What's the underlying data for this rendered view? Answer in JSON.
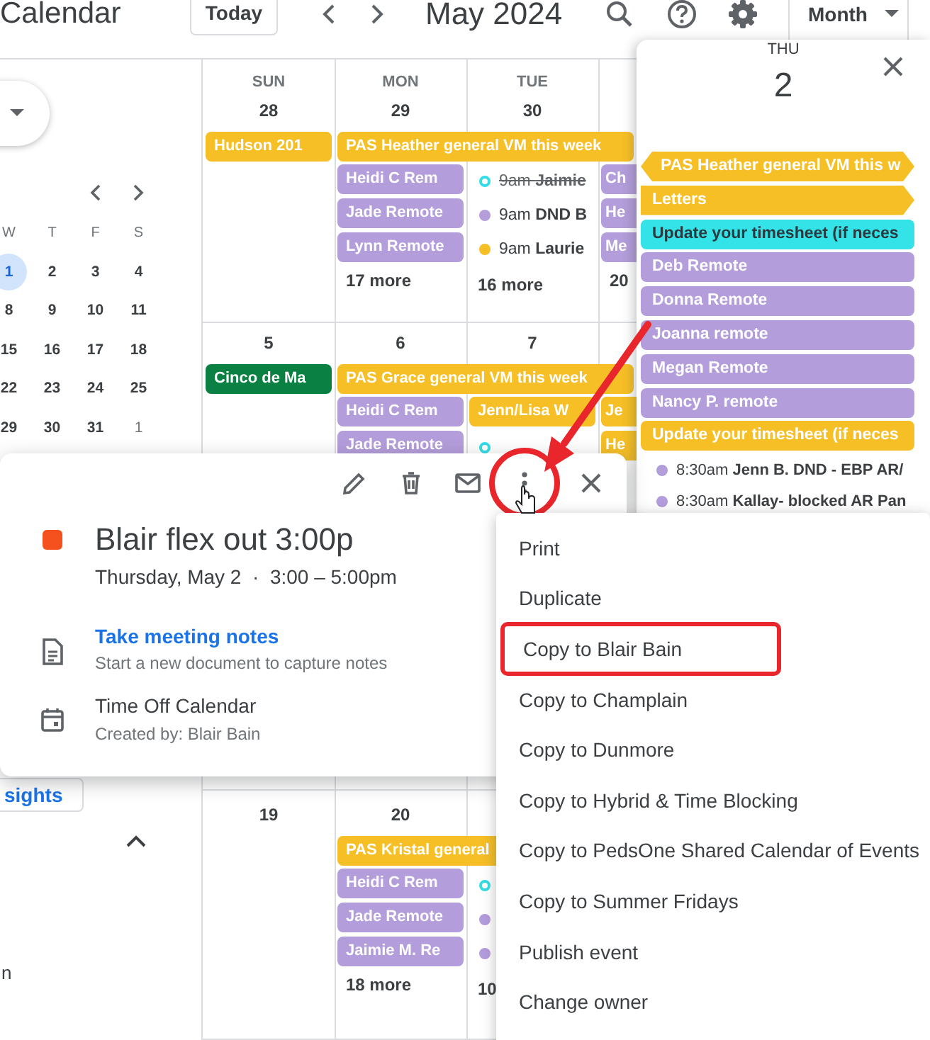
{
  "header": {
    "title": "Calendar",
    "today_button": "Today",
    "period": "May 2024",
    "view_button": "Month"
  },
  "sidebar": {
    "mini_calendar": {
      "weekdays": [
        "W",
        "T",
        "F",
        "S"
      ],
      "weeks": [
        [
          {
            "day": "1",
            "selected": true,
            "other_month": false
          },
          {
            "day": "2",
            "selected": false,
            "other_month": false
          },
          {
            "day": "3",
            "selected": false,
            "other_month": false
          },
          {
            "day": "4",
            "selected": false,
            "other_month": false
          }
        ],
        [
          {
            "day": "8",
            "selected": false,
            "other_month": false
          },
          {
            "day": "9",
            "selected": false,
            "other_month": false
          },
          {
            "day": "10",
            "selected": false,
            "other_month": false
          },
          {
            "day": "11",
            "selected": false,
            "other_month": false
          }
        ],
        [
          {
            "day": "15",
            "selected": false,
            "other_month": false
          },
          {
            "day": "16",
            "selected": false,
            "other_month": false
          },
          {
            "day": "17",
            "selected": false,
            "other_month": false
          },
          {
            "day": "18",
            "selected": false,
            "other_month": false
          }
        ],
        [
          {
            "day": "22",
            "selected": false,
            "other_month": false
          },
          {
            "day": "23",
            "selected": false,
            "other_month": false
          },
          {
            "day": "24",
            "selected": false,
            "other_month": false
          },
          {
            "day": "25",
            "selected": false,
            "other_month": false
          }
        ],
        [
          {
            "day": "29",
            "selected": false,
            "other_month": false
          },
          {
            "day": "30",
            "selected": false,
            "other_month": false
          },
          {
            "day": "31",
            "selected": false,
            "other_month": false
          },
          {
            "day": "1",
            "selected": false,
            "other_month": true
          }
        ]
      ]
    },
    "insights_button": "sights",
    "cut_text": "n"
  },
  "month_grid": {
    "weeks": [
      {
        "days": [
          {
            "weekday": "SUN",
            "date": "28",
            "banner": {
              "text": "Hudson 201",
              "color": "#f6bf26",
              "extends": false
            }
          },
          {
            "weekday": "MON",
            "date": "29",
            "banner": {
              "text": "PAS Heather general VM this week",
              "color": "#f6bf26",
              "extends": true
            },
            "events": [
              {
                "kind": "chip",
                "text": "Heidi C Rem",
                "color": "#b39ddb"
              },
              {
                "kind": "chip",
                "text": "Jade Remote",
                "color": "#b39ddb"
              },
              {
                "kind": "chip",
                "text": "Lynn Remote",
                "color": "#b39ddb"
              },
              {
                "kind": "more",
                "text": "17 more"
              }
            ]
          },
          {
            "weekday": "TUE",
            "date": "30",
            "events": [
              {
                "kind": "dot",
                "time": "9am",
                "title": "Jaimie",
                "color": "#33dde6",
                "outlined": true,
                "declined": true
              },
              {
                "kind": "dot",
                "time": "9am",
                "title": "DND B",
                "color": "#b39ddb",
                "outlined": false,
                "declined": false
              },
              {
                "kind": "dot",
                "time": "9am",
                "title": "Laurie",
                "color": "#f6bf26",
                "outlined": false,
                "declined": false
              },
              {
                "kind": "more",
                "text": "16 more"
              }
            ]
          },
          {
            "events": [
              {
                "kind": "chip",
                "text": "Ch",
                "color": "#b39ddb"
              },
              {
                "kind": "chip",
                "text": "He",
                "color": "#b39ddb"
              },
              {
                "kind": "chip",
                "text": "Me",
                "color": "#b39ddb"
              },
              {
                "kind": "more",
                "text": "20"
              }
            ]
          }
        ]
      },
      {
        "days": [
          {
            "date": "5",
            "banner": {
              "text": "Cinco de Ma",
              "color": "#0b8043",
              "extends": false
            }
          },
          {
            "date": "6",
            "banner": {
              "text": "PAS Grace general VM this week",
              "color": "#f6bf26",
              "extends": true
            },
            "events": [
              {
                "kind": "chip",
                "text": "Heidi C Rem",
                "color": "#b39ddb"
              },
              {
                "kind": "chip",
                "text": "Jade Remote",
                "color": "#b39ddb"
              }
            ]
          },
          {
            "date": "7",
            "events": [
              {
                "kind": "chip",
                "text": "Jenn/Lisa W",
                "color": "#f6bf26"
              },
              {
                "kind": "dot",
                "color": "#33dde6",
                "outlined": true
              }
            ]
          },
          {
            "events": [
              {
                "kind": "chip",
                "text": "Je",
                "color": "#f6bf26"
              },
              {
                "kind": "chip",
                "text": "He",
                "color": "#f6bf26"
              }
            ]
          }
        ]
      },
      {
        "days": [
          {
            "date": "19"
          },
          {
            "date": "20",
            "banner": {
              "text": "PAS Kristal general",
              "color": "#f6bf26",
              "extends": true
            },
            "events": [
              {
                "kind": "chip",
                "text": "Heidi C Rem",
                "color": "#b39ddb"
              },
              {
                "kind": "chip",
                "text": "Jade Remote",
                "color": "#b39ddb"
              },
              {
                "kind": "chip",
                "text": "Jaimie M. Re",
                "color": "#b39ddb"
              },
              {
                "kind": "more",
                "text": "18 more"
              }
            ]
          },
          {
            "events": [
              {
                "kind": "dot",
                "color": "#33dde6",
                "outlined": true
              },
              {
                "kind": "dot",
                "color": "#b39ddb",
                "outlined": false
              },
              {
                "kind": "dot",
                "color": "#b39ddb",
                "outlined": false
              },
              {
                "kind": "more",
                "text": "10"
              }
            ]
          }
        ]
      }
    ]
  },
  "day_panel": {
    "weekday": "THU",
    "date": "2",
    "events": [
      {
        "kind": "chip",
        "text": "PAS Heather general VM this w",
        "color": "#f6bf26",
        "dark_text": false,
        "continues_before": true,
        "continues_after": true
      },
      {
        "kind": "chip",
        "text": "Letters",
        "color": "#f6bf26",
        "dark_text": false,
        "continues_before": false,
        "continues_after": true
      },
      {
        "kind": "chip",
        "text": "Update your timesheet (if neces",
        "color": "#33e3e8",
        "dark_text": true,
        "continues_before": false,
        "continues_after": false
      },
      {
        "kind": "chip",
        "text": "Deb Remote",
        "color": "#b39ddb",
        "dark_text": false,
        "continues_before": false,
        "continues_after": false
      },
      {
        "kind": "chip",
        "text": "Donna Remote",
        "color": "#b39ddb",
        "dark_text": false,
        "continues_before": false,
        "continues_after": false
      },
      {
        "kind": "chip",
        "text": "Joanna remote",
        "color": "#b39ddb",
        "dark_text": false,
        "continues_before": false,
        "continues_after": false
      },
      {
        "kind": "chip",
        "text": "Megan Remote",
        "color": "#b39ddb",
        "dark_text": false,
        "continues_before": false,
        "continues_after": false
      },
      {
        "kind": "chip",
        "text": "Nancy P. remote",
        "color": "#b39ddb",
        "dark_text": false,
        "continues_before": false,
        "continues_after": false
      },
      {
        "kind": "chip",
        "text": "Update your timesheet (if neces",
        "color": "#f6bf26",
        "dark_text": false,
        "continues_before": false,
        "continues_after": false
      },
      {
        "kind": "dot",
        "time": "8:30am",
        "title": "Jenn B. DND - EBP AR/",
        "color": "#b39ddb"
      },
      {
        "kind": "dot",
        "time": "8:30am",
        "title": "Kallay- blocked AR Pan",
        "color": "#b39ddb"
      }
    ]
  },
  "event_popup": {
    "toolbar": [
      {
        "kind": "edit",
        "circled": false
      },
      {
        "kind": "delete",
        "circled": false
      },
      {
        "kind": "email",
        "circled": false
      },
      {
        "kind": "more",
        "circled": true
      },
      {
        "kind": "close",
        "circled": false
      }
    ],
    "title": "Blair flex out 3:00p",
    "color": "#f4511e",
    "when": "Thursday, May 2  ·  3:00 – 5:00pm",
    "notes_link": "Take meeting notes",
    "notes_hint": "Start a new document to capture notes",
    "calendar": "Time Off Calendar",
    "created_by": "Created by: Blair Bain"
  },
  "more_menu": {
    "items": [
      {
        "label": "Print",
        "highlighted": false
      },
      {
        "label": "Duplicate",
        "highlighted": false
      },
      {
        "label": "Copy to Blair Bain",
        "highlighted": true
      },
      {
        "label": "Copy to Champlain",
        "highlighted": false
      },
      {
        "label": "Copy to Dunmore",
        "highlighted": false
      },
      {
        "label": "Copy to Hybrid & Time Blocking",
        "highlighted": false
      },
      {
        "label": "Copy to PedsOne Shared Calendar of Events",
        "highlighted": false
      },
      {
        "label": "Copy to Summer Fridays",
        "highlighted": false
      },
      {
        "label": "Publish event",
        "highlighted": false
      },
      {
        "label": "Change owner",
        "highlighted": false
      }
    ]
  }
}
